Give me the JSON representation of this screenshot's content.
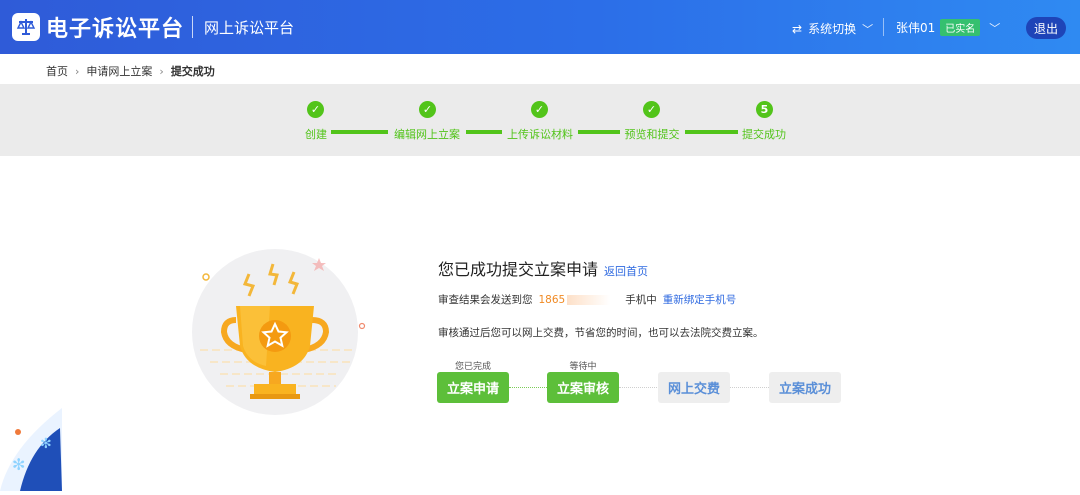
{
  "header": {
    "brand": "电子诉讼平台",
    "subtitle": "网上诉讼平台",
    "system_switch": "系统切换",
    "user_name": "张伟01",
    "verified_badge": "已实名",
    "logout": "退出"
  },
  "breadcrumb": [
    "首页",
    "申请网上立案",
    "提交成功"
  ],
  "steps": [
    {
      "label": "创建",
      "status": "done"
    },
    {
      "label": "编辑网上立案",
      "status": "done"
    },
    {
      "label": "上传诉讼材料",
      "status": "done"
    },
    {
      "label": "预览和提交",
      "status": "done"
    },
    {
      "label": "提交成功",
      "status": "current",
      "number": "5"
    }
  ],
  "result": {
    "title": "您已成功提交立案申请",
    "back_home": "返回首页",
    "line1_prefix": "审查结果会发送到您",
    "phone_visible": "1865",
    "line1_suffix": "手机中",
    "rebind_phone": "重新绑定手机号",
    "line2": "审核通过后您可以网上交费，节省您的时间，也可以去法院交费立案。"
  },
  "progress": [
    {
      "label": "立案申请",
      "caption": "您已完成",
      "state": "done"
    },
    {
      "label": "立案审核",
      "caption": "等待中",
      "state": "done"
    },
    {
      "label": "网上交费",
      "caption": "",
      "state": "pending"
    },
    {
      "label": "立案成功",
      "caption": "",
      "state": "pending"
    }
  ],
  "colors": {
    "header_start": "#2f5bd8",
    "header_end": "#2f8af2",
    "step_green": "#52c41a",
    "button_green": "#5dbf3a",
    "link_blue": "#2f6ae0",
    "phone_orange": "#f08a24",
    "verified_green": "#35c06f"
  },
  "icons": {
    "logo": "scales-of-justice-icon",
    "system_switch": "swap-arrows-icon",
    "dropdown": "chevron-down-icon",
    "step_done": "check-icon",
    "illustration": "trophy-star-icon"
  }
}
